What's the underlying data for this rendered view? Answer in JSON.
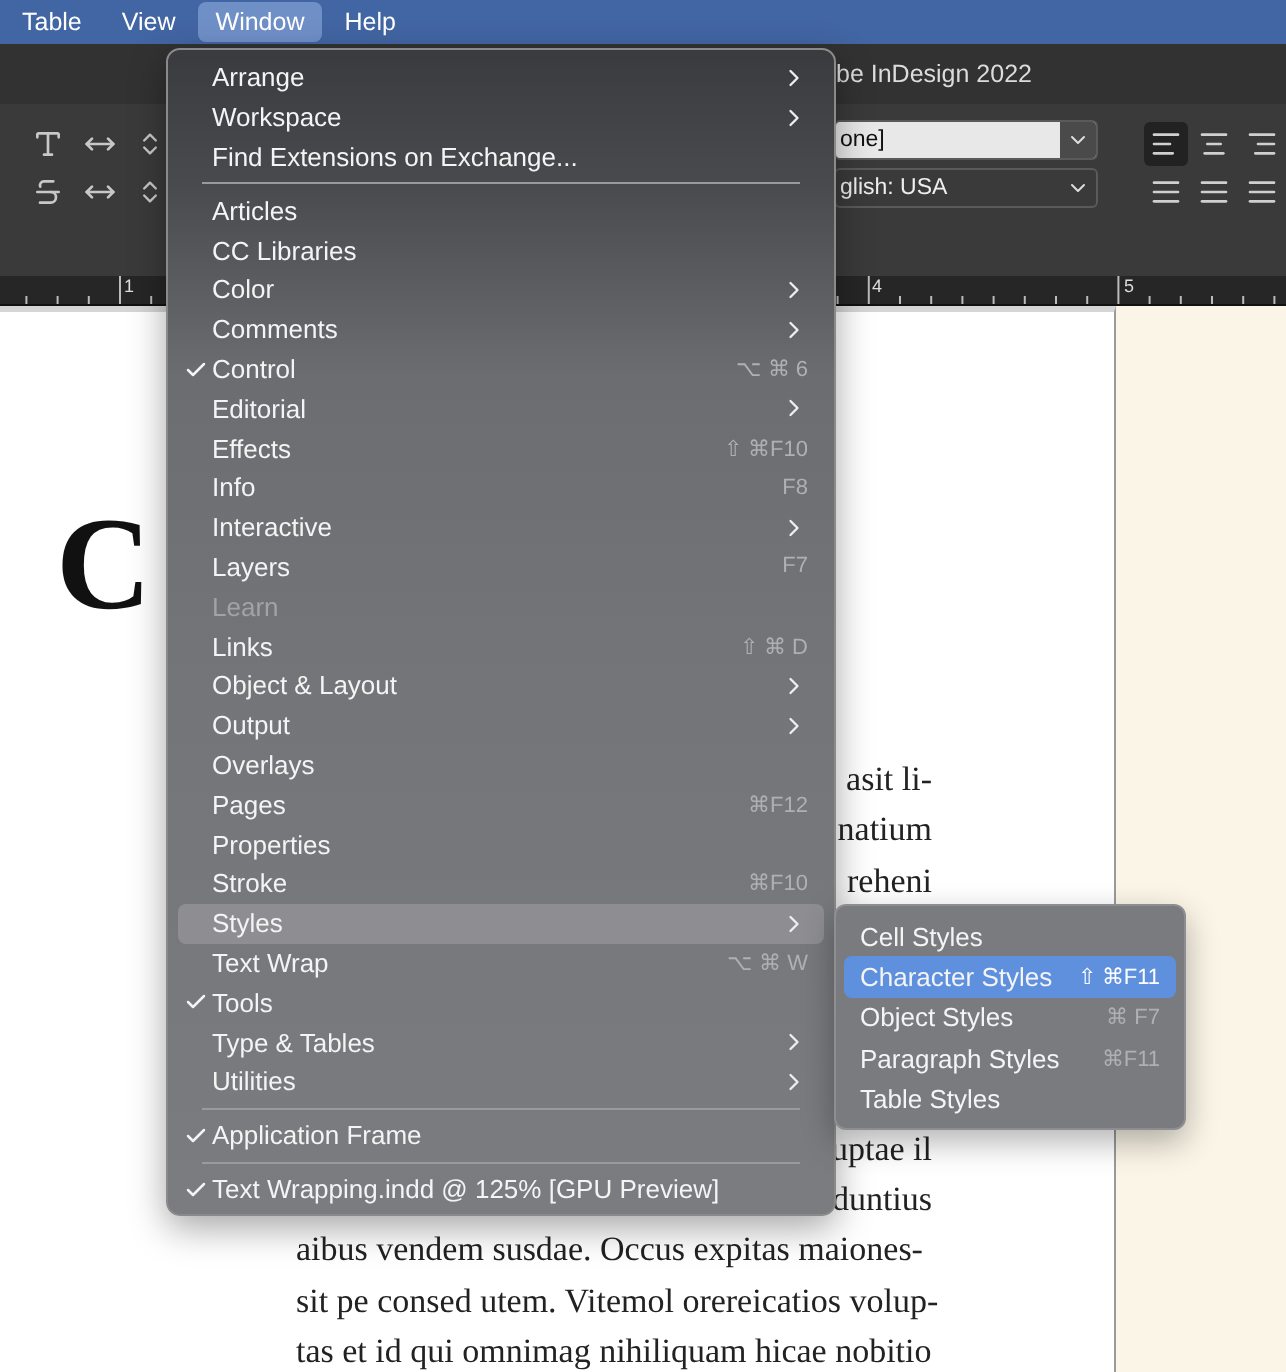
{
  "menu_bar": {
    "items": [
      {
        "label": "Table",
        "selected": false
      },
      {
        "label": "View",
        "selected": false
      },
      {
        "label": "Window",
        "selected": true
      },
      {
        "label": "Help",
        "selected": false
      }
    ]
  },
  "window": {
    "title": "be InDesign 2022"
  },
  "control_panel": {
    "style_field": {
      "value": "one]"
    },
    "language_field": {
      "value": "glish: USA"
    },
    "align_buttons": [
      {
        "kind": "left",
        "selected": true
      },
      {
        "kind": "center",
        "selected": false
      },
      {
        "kind": "right",
        "selected": false
      },
      {
        "kind": "justify",
        "selected": false
      },
      {
        "kind": "justify",
        "selected": false
      },
      {
        "kind": "justify",
        "selected": false
      }
    ]
  },
  "ruler": {
    "numbers": [
      "1",
      "4",
      "5"
    ]
  },
  "document": {
    "heading": "C",
    "lines_top": [
      "asit li-",
      "natium",
      "reheni"
    ],
    "lines_bottom": [
      "uptae il",
      "duntius"
    ],
    "lines_full": [
      "aibus vendem susdae. Occus expitas maiones-",
      "sit pe consed utem. Vitemol orereicatios volup-",
      "tas et id qui omnimag nihiliquam hicae nobitio"
    ]
  },
  "window_menu": {
    "groups": [
      [
        {
          "label": "Arrange",
          "checked": false,
          "disabled": false,
          "submenu": true,
          "selected": false
        },
        {
          "label": "Workspace",
          "checked": false,
          "disabled": false,
          "submenu": true,
          "selected": false
        },
        {
          "label": "Find Extensions on Exchange...",
          "checked": false,
          "disabled": false,
          "submenu": false,
          "selected": false
        }
      ],
      [
        {
          "label": "Articles",
          "checked": false,
          "disabled": false,
          "submenu": false,
          "selected": false
        },
        {
          "label": "CC Libraries",
          "checked": false,
          "disabled": false,
          "submenu": false,
          "selected": false
        },
        {
          "label": "Color",
          "checked": false,
          "disabled": false,
          "submenu": true,
          "selected": false
        },
        {
          "label": "Comments",
          "checked": false,
          "disabled": false,
          "submenu": true,
          "selected": false
        },
        {
          "label": "Control",
          "checked": true,
          "disabled": false,
          "submenu": false,
          "selected": false,
          "shortcut": "⌥ ⌘ 6"
        },
        {
          "label": "Editorial",
          "checked": false,
          "disabled": false,
          "submenu": true,
          "selected": false
        },
        {
          "label": "Effects",
          "checked": false,
          "disabled": false,
          "submenu": false,
          "selected": false,
          "shortcut": "⇧ ⌘F10"
        },
        {
          "label": "Info",
          "checked": false,
          "disabled": false,
          "submenu": false,
          "selected": false,
          "shortcut": "F8"
        },
        {
          "label": "Interactive",
          "checked": false,
          "disabled": false,
          "submenu": true,
          "selected": false
        },
        {
          "label": "Layers",
          "checked": false,
          "disabled": false,
          "submenu": false,
          "selected": false,
          "shortcut": "F7"
        },
        {
          "label": "Learn",
          "checked": false,
          "disabled": true,
          "submenu": false,
          "selected": false
        },
        {
          "label": "Links",
          "checked": false,
          "disabled": false,
          "submenu": false,
          "selected": false,
          "shortcut": "⇧ ⌘ D"
        },
        {
          "label": "Object & Layout",
          "checked": false,
          "disabled": false,
          "submenu": true,
          "selected": false
        },
        {
          "label": "Output",
          "checked": false,
          "disabled": false,
          "submenu": true,
          "selected": false
        },
        {
          "label": "Overlays",
          "checked": false,
          "disabled": false,
          "submenu": false,
          "selected": false
        },
        {
          "label": "Pages",
          "checked": false,
          "disabled": false,
          "submenu": false,
          "selected": false,
          "shortcut": "⌘F12"
        },
        {
          "label": "Properties",
          "checked": false,
          "disabled": false,
          "submenu": false,
          "selected": false
        },
        {
          "label": "Stroke",
          "checked": false,
          "disabled": false,
          "submenu": false,
          "selected": false,
          "shortcut": "⌘F10"
        },
        {
          "label": "Styles",
          "checked": false,
          "disabled": false,
          "submenu": true,
          "selected": true
        },
        {
          "label": "Text Wrap",
          "checked": false,
          "disabled": false,
          "submenu": false,
          "selected": false,
          "shortcut": "⌥ ⌘ W"
        },
        {
          "label": "Tools",
          "checked": true,
          "disabled": false,
          "submenu": false,
          "selected": false
        },
        {
          "label": "Type & Tables",
          "checked": false,
          "disabled": false,
          "submenu": true,
          "selected": false
        },
        {
          "label": "Utilities",
          "checked": false,
          "disabled": false,
          "submenu": true,
          "selected": false
        }
      ],
      [
        {
          "label": "Application Frame",
          "checked": true,
          "disabled": false,
          "submenu": false,
          "selected": false
        }
      ],
      [
        {
          "label": "Text Wrapping.indd @ 125% [GPU Preview]",
          "checked": true,
          "disabled": false,
          "submenu": false,
          "selected": false
        }
      ]
    ]
  },
  "styles_submenu": {
    "items": [
      {
        "label": "Cell Styles",
        "selected": false
      },
      {
        "label": "Character Styles",
        "selected": true,
        "shortcut": "⇧ ⌘F11"
      },
      {
        "label": "Object Styles",
        "selected": false,
        "shortcut": "⌘ F7"
      },
      {
        "label": "Paragraph Styles",
        "selected": false,
        "shortcut": "⌘F11"
      },
      {
        "label": "Table Styles",
        "selected": false
      }
    ]
  }
}
